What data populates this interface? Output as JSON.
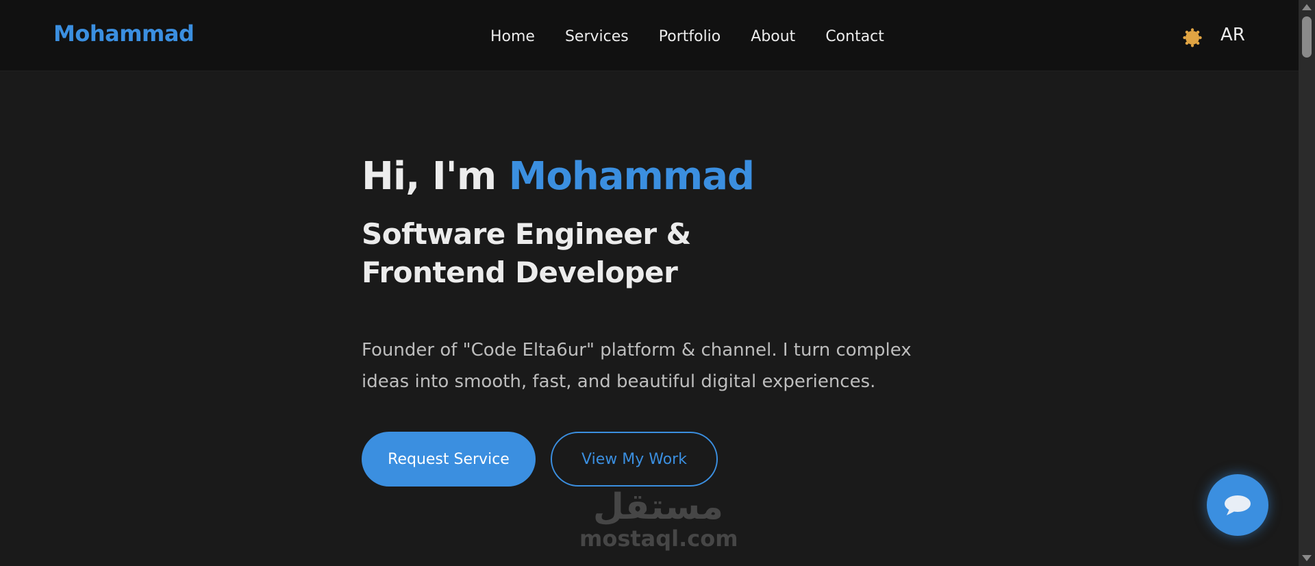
{
  "nav": {
    "brand": "Mohammad",
    "links": [
      "Home",
      "Services",
      "Portfolio",
      "About",
      "Contact"
    ],
    "theme_icon": "sun-icon",
    "lang_label": "AR"
  },
  "hero": {
    "title_prefix": "Hi, I'm ",
    "title_name": "Mohammad",
    "subtitle": "Software Engineer & Frontend Developer",
    "description": "Founder of \"Code Elta6ur\" platform & channel. I turn complex ideas into smooth, fast, and beautiful digital experiences.",
    "primary_button": "Request Service",
    "secondary_button": "View My Work"
  },
  "watermark": {
    "arabic": "مستقل",
    "latin": "mostaql.com"
  },
  "chat": {
    "icon": "chat-bubble-icon"
  },
  "colors": {
    "accent": "#3b8fe0",
    "background": "#1a1a1a",
    "navbar": "#111111",
    "sun": "#e0a443"
  }
}
